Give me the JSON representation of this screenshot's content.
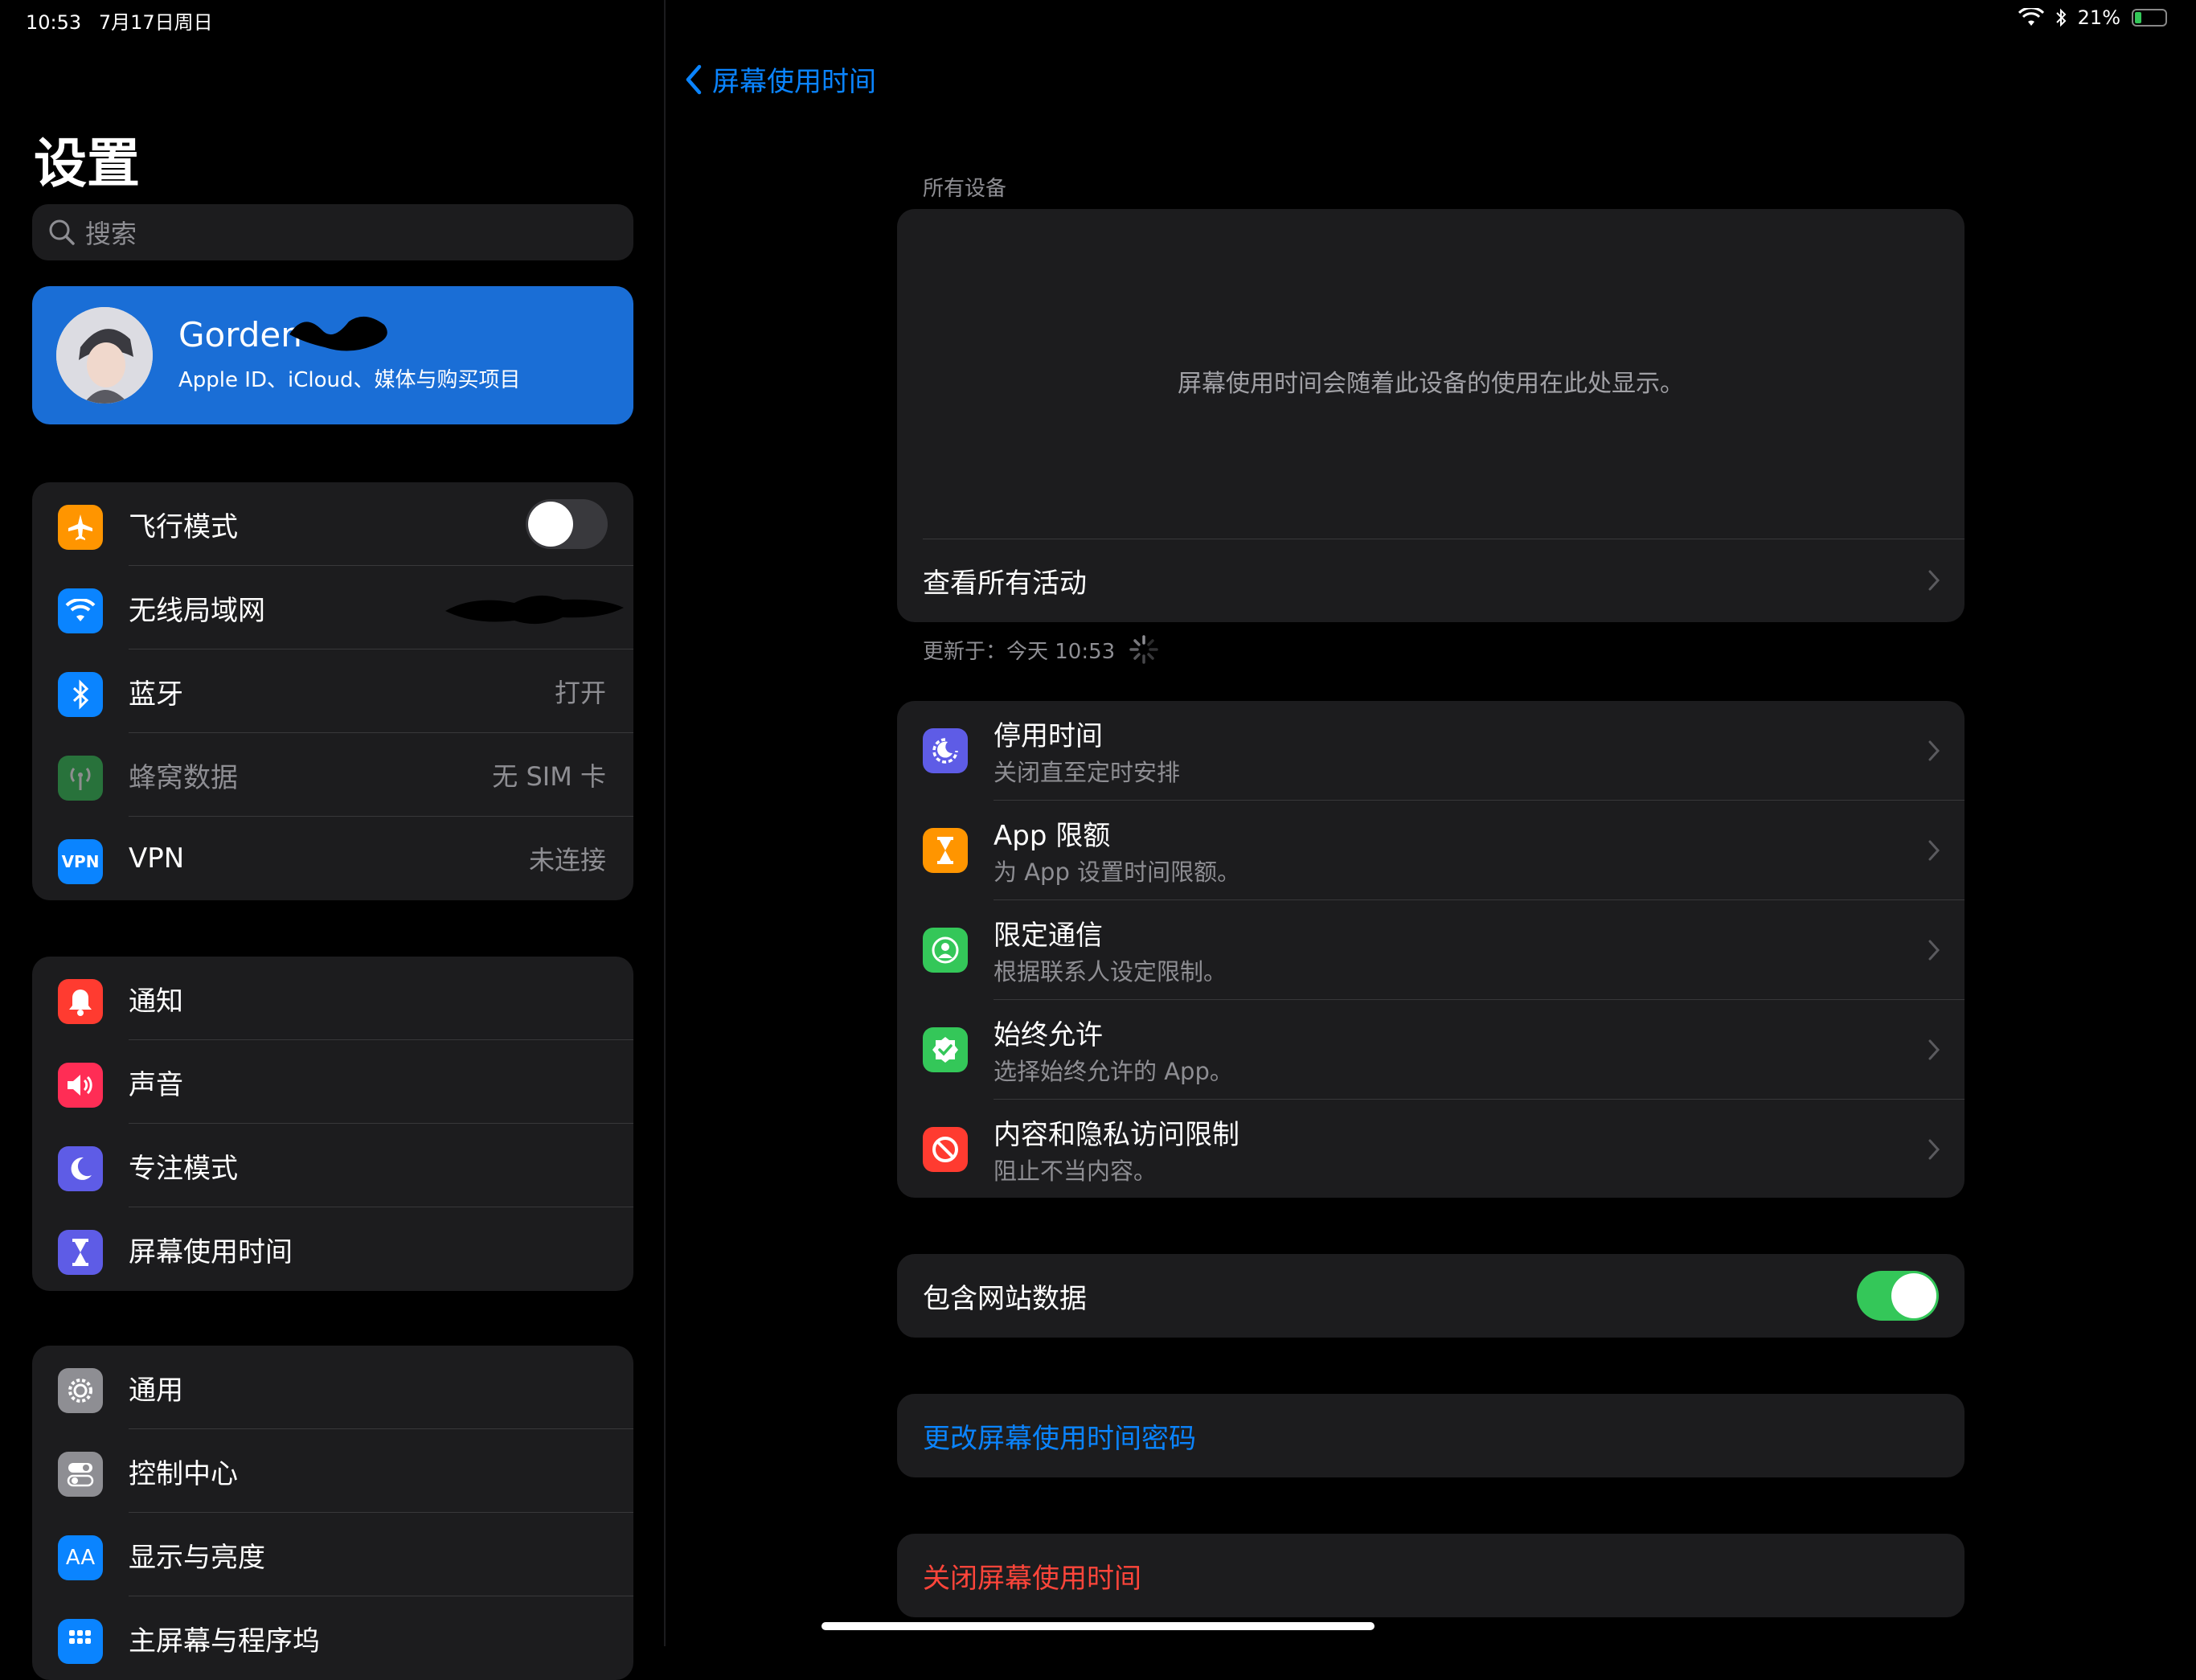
{
  "status_bar": {
    "time": "10:53",
    "date": "7月17日周日",
    "battery": "21%",
    "battery_level": 0.21
  },
  "sidebar": {
    "title": "设置",
    "search_placeholder": "搜索",
    "profile": {
      "name": "Gorden",
      "subtitle": "Apple ID、iCloud、媒体与购买项目"
    },
    "group1": [
      {
        "label": "飞行模式",
        "icon": "airplane-icon",
        "color": "#ff9500",
        "toggle": false
      },
      {
        "label": "无线局域网",
        "icon": "wifi-icon",
        "color": "#0a84ff"
      },
      {
        "label": "蓝牙",
        "icon": "bluetooth-icon",
        "color": "#0a84ff",
        "value": "打开"
      },
      {
        "label": "蜂窝数据",
        "icon": "antenna-icon",
        "color": "#34c759",
        "value": "无 SIM 卡",
        "disabled": true
      },
      {
        "label": "VPN",
        "icon": "vpn-icon",
        "color": "#0a84ff",
        "value": "未连接",
        "icon_text": "VPN"
      }
    ],
    "group2": [
      {
        "label": "通知",
        "icon": "bell-icon",
        "color": "#ff3b30"
      },
      {
        "label": "声音",
        "icon": "speaker-icon",
        "color": "#ff2d55"
      },
      {
        "label": "专注模式",
        "icon": "moon-icon",
        "color": "#5e5ce6"
      },
      {
        "label": "屏幕使用时间",
        "icon": "hourglass-icon",
        "color": "#5e5ce6"
      }
    ],
    "group3": [
      {
        "label": "通用",
        "icon": "gear-icon",
        "color": "#8e8e93"
      },
      {
        "label": "控制中心",
        "icon": "switches-icon",
        "color": "#8e8e93"
      },
      {
        "label": "显示与亮度",
        "icon": "text-size-icon",
        "color": "#0a84ff",
        "icon_text": "AA"
      },
      {
        "label": "主屏幕与程序坞",
        "icon": "grid-icon",
        "color": "#0a84ff"
      }
    ]
  },
  "detail": {
    "back_label": "屏幕使用时间",
    "all_devices_header": "所有设备",
    "empty_message": "屏幕使用时间会随着此设备的使用在此处显示。",
    "see_all_activity": "查看所有活动",
    "updated_text": "更新于：今天 10:53",
    "items": [
      {
        "title": "停用时间",
        "subtitle": "关闭直至定时安排",
        "icon": "downtime-icon",
        "color": "#5e5ce6"
      },
      {
        "title": "App 限额",
        "subtitle": "为 App 设置时间限额。",
        "icon": "hourglass-icon",
        "color": "#ff9500"
      },
      {
        "title": "限定通信",
        "subtitle": "根据联系人设定限制。",
        "icon": "contact-icon",
        "color": "#34c759"
      },
      {
        "title": "始终允许",
        "subtitle": "选择始终允许的 App。",
        "icon": "checkmark-badge-icon",
        "color": "#34c759"
      },
      {
        "title": "内容和隐私访问限制",
        "subtitle": "阻止不当内容。",
        "icon": "restriction-icon",
        "color": "#ff3b30"
      }
    ],
    "include_website_data": {
      "label": "包含网站数据",
      "on": true
    },
    "change_passcode": "更改屏幕使用时间密码",
    "turn_off": "关闭屏幕使用时间"
  },
  "colors": {
    "accent": "#0a84ff",
    "danger": "#ff453a",
    "toggle_on": "#34c759",
    "card": "#1c1c1e"
  }
}
